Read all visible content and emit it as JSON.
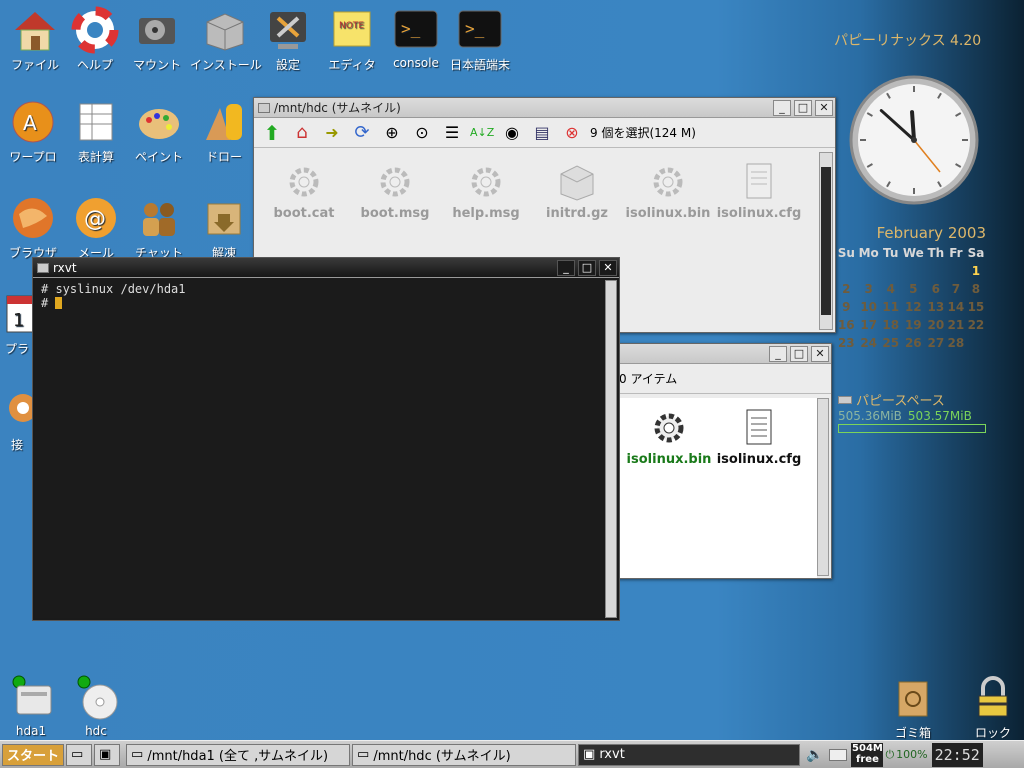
{
  "desktop_top_icons": [
    {
      "label": "ファイル",
      "icon": "home-icon"
    },
    {
      "label": "ヘルプ",
      "icon": "lifebuoy-icon"
    },
    {
      "label": "マウント",
      "icon": "harddisk-icon"
    },
    {
      "label": "インストール",
      "icon": "box-icon"
    },
    {
      "label": "設定",
      "icon": "tools-icon"
    },
    {
      "label": "エディタ",
      "icon": "note-icon"
    },
    {
      "label": "console",
      "icon": "terminal-icon"
    },
    {
      "label": "日本語端末",
      "icon": "terminal-jp-icon"
    }
  ],
  "desktop_left_icons": [
    {
      "label": "ワープロ",
      "icon": "wordprocessor-icon"
    },
    {
      "label": "表計算",
      "icon": "spreadsheet-icon"
    },
    {
      "label": "ペイント",
      "icon": "palette-icon"
    },
    {
      "label": "ドロー",
      "icon": "draw-icon"
    },
    {
      "label": "ブラウザ",
      "icon": "browser-icon"
    },
    {
      "label": "メール",
      "icon": "mail-icon"
    },
    {
      "label": "チャット",
      "icon": "chat-icon"
    },
    {
      "label": "解凍",
      "icon": "unpack-icon"
    },
    {
      "label": "プラ",
      "icon": "calendar-icon"
    },
    {
      "label": "接",
      "icon": "connect-icon"
    }
  ],
  "desktop_drives": [
    {
      "label": "hda1",
      "icon": "drive-icon"
    },
    {
      "label": "hdc",
      "icon": "cdrom-icon"
    }
  ],
  "desktop_right_icons": [
    {
      "label": "ゴミ箱",
      "icon": "trash-icon"
    },
    {
      "label": "ロック",
      "icon": "lock-icon"
    }
  ],
  "branding": "パピーリナックス 4.20",
  "clock": {
    "hour": 11,
    "minute": 52
  },
  "calendar": {
    "month": "February 2003",
    "days": [
      "Su",
      "Mo",
      "Tu",
      "We",
      "Th",
      "Fr",
      "Sa"
    ],
    "rows": [
      [
        "",
        "",
        "",
        "",
        "",
        "",
        "1"
      ],
      [
        "2",
        "3",
        "4",
        "5",
        "6",
        "7",
        "8"
      ],
      [
        "9",
        "10",
        "11",
        "12",
        "13",
        "14",
        "15"
      ],
      [
        "16",
        "17",
        "18",
        "19",
        "20",
        "21",
        "22"
      ],
      [
        "23",
        "24",
        "25",
        "26",
        "27",
        "28",
        ""
      ]
    ],
    "today": "1"
  },
  "space": {
    "title": "パピースペース",
    "used": "505.36MiB",
    "total": "503.57MiB"
  },
  "rox_hdc": {
    "title": "/mnt/hdc (サムネイル)",
    "status": "9 個を選択(124 M)",
    "files": [
      "boot.cat",
      "boot.msg",
      "help.msg",
      "initrd.gz",
      "isolinux.bin",
      "isolinux.cfg"
    ]
  },
  "rox_hda1": {
    "status": "0 アイテム",
    "files": [
      "isolinux.bin",
      "isolinux.cfg"
    ]
  },
  "rxvt": {
    "title": "rxvt",
    "lines": [
      "# syslinux /dev/hda1",
      "#"
    ]
  },
  "taskbar": {
    "start": "スタート",
    "tasks": [
      "/mnt/hda1 (全て ,サムネイル)",
      "/mnt/hdc (サムネイル)",
      "rxvt"
    ],
    "free_top": "504M",
    "free_bottom": "free",
    "battery": "100%",
    "time": "22:52"
  }
}
